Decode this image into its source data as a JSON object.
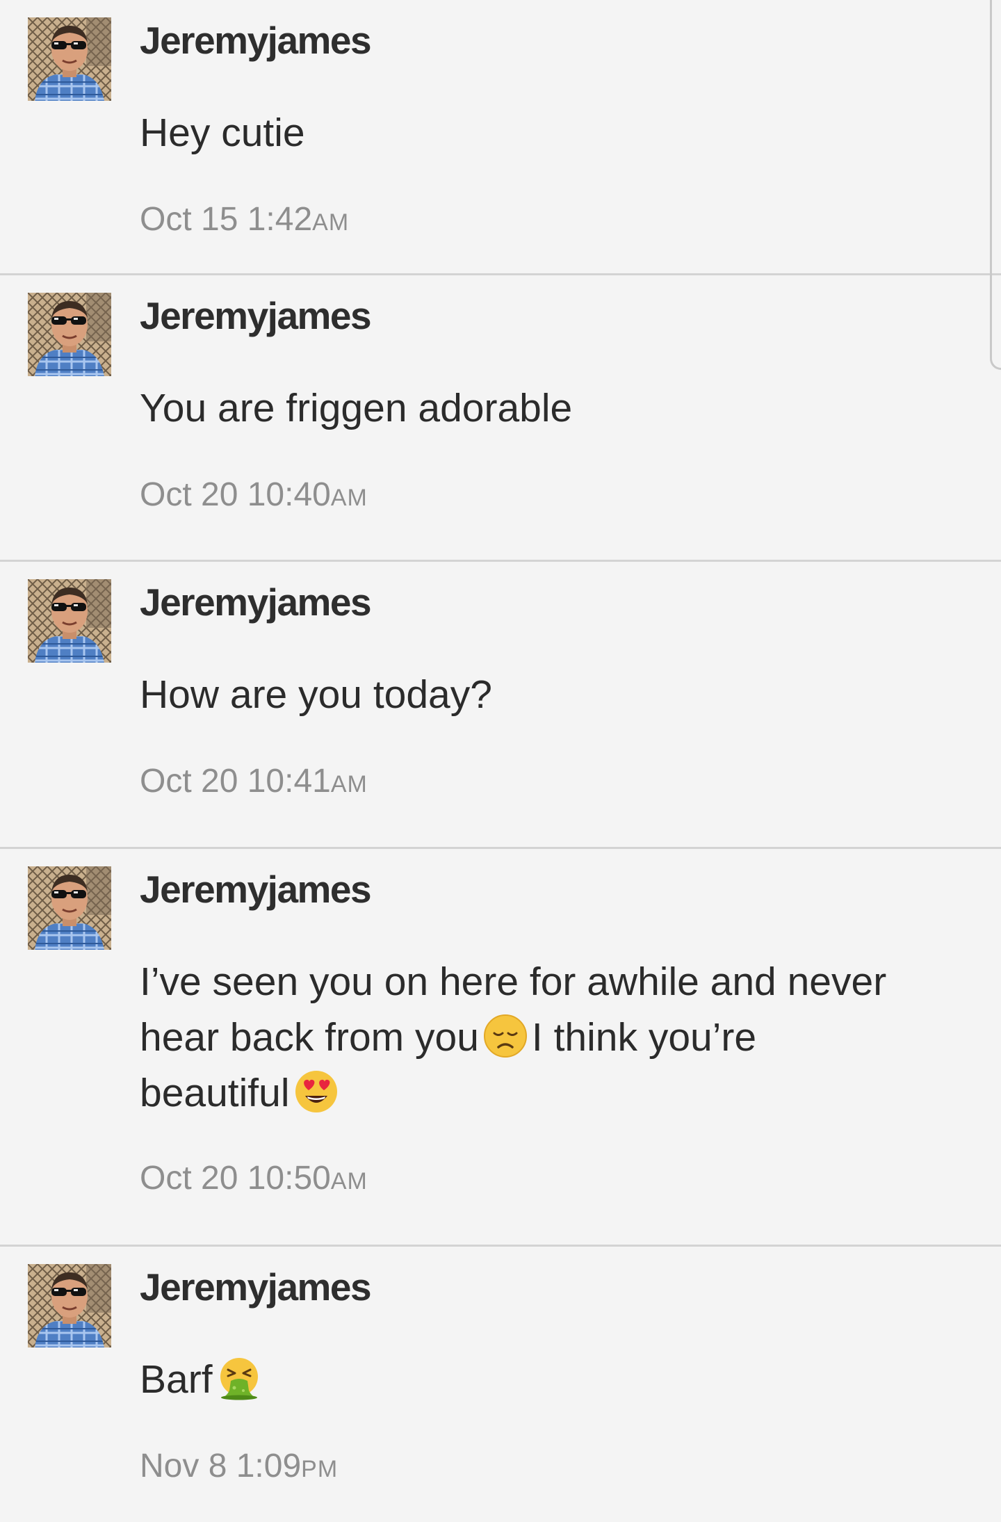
{
  "messages": [
    {
      "sender": "Jeremyjames",
      "text": "Hey cutie",
      "date": "Oct 15 1:42",
      "period": "AM"
    },
    {
      "sender": "Jeremyjames",
      "text": "You are friggen adorable",
      "date": "Oct 20 10:40",
      "period": "AM"
    },
    {
      "sender": "Jeremyjames",
      "text": "How are you today?",
      "date": "Oct 20 10:41",
      "period": "AM"
    },
    {
      "sender": "Jeremyjames",
      "text_line1": "I’ve seen you on here for awhile and never",
      "text_line2a": "hear back from you",
      "text_line2b": "I think you’re",
      "text_line3": "beautiful",
      "emoji1": "disappointed-face-icon",
      "emoji2": "heart-eyes-face-icon",
      "date": "Oct 20 10:50",
      "period": "AM"
    },
    {
      "sender": "Jeremyjames",
      "text": "Barf",
      "emoji": "vomiting-face-icon",
      "date": "Nov 8 1:09",
      "period": "PM"
    }
  ],
  "colors": {
    "background": "#f4f4f4",
    "divider": "#d3d3d3",
    "sender": "#2e2e2e",
    "text": "#2b2b2b",
    "timestamp": "#8e8e8e"
  }
}
